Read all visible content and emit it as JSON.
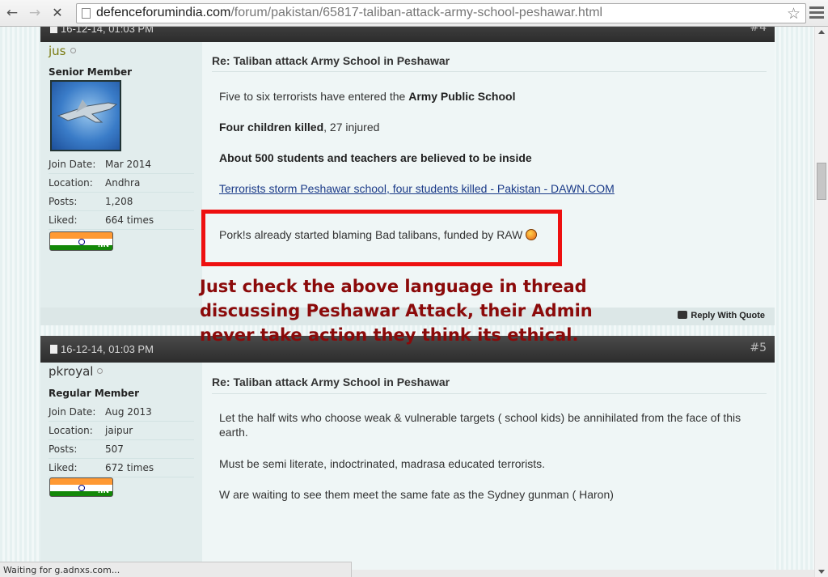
{
  "browser": {
    "url_domain": "defenceforumindia.com",
    "url_path": "/forum/pakistan/65817-taliban-attack-army-school-peshawar.html",
    "back_glyph": "←",
    "forward_glyph": "→",
    "stop_glyph": "✕",
    "star_glyph": "☆",
    "status_text": "Waiting for g.adnxs.com..."
  },
  "post1": {
    "header_date": "16-12-14, 01:03 PM",
    "post_number": "#4",
    "username": "jus",
    "user_title": "Senior Member",
    "info": [
      {
        "k": "Join Date:",
        "v": "Mar 2014"
      },
      {
        "k": "Location:",
        "v": "Andhra"
      },
      {
        "k": "Posts:",
        "v": "1,208"
      },
      {
        "k": "Liked:",
        "v": "664 times"
      }
    ],
    "flag_tld": ".IN",
    "title": "Re: Taliban attack Army School in Peshawar",
    "p1_text": "Five to six terrorists have entered the ",
    "p1_bold": "Army Public School",
    "p2_bold": "Four children killed",
    "p2_text": ", 27 injured",
    "p3_bold": "About 500 students and teachers are believed to be inside",
    "link": "Terrorists storm Peshawar school, four students killed - Pakistan - DAWN.COM",
    "quote": "Pork!s already started blaming Bad talibans, funded by RAW",
    "reply_label": "Reply With Quote"
  },
  "annotation": {
    "text": "Just check the above language in thread discussing Peshawar Attack, their Admin never take action they think its ethical.",
    "color": "#8b0a0a"
  },
  "post2": {
    "header_date": "16-12-14, 01:03 PM",
    "post_number": "#5",
    "username": "pkroyal",
    "user_title": "Regular Member",
    "info": [
      {
        "k": "Join Date:",
        "v": "Aug 2013"
      },
      {
        "k": "Location:",
        "v": "jaipur"
      },
      {
        "k": "Posts:",
        "v": "507"
      },
      {
        "k": "Liked:",
        "v": "672 times"
      }
    ],
    "flag_tld": ".IN",
    "title": "Re: Taliban attack Army School in Peshawar",
    "p1": "Let the half wits who choose weak & vulnerable targets ( school kids) be annihilated from the face of this earth.",
    "p2": "Must be semi literate, indoctrinated, madrasa educated terrorists.",
    "p3": "W are waiting to see them meet the same fate as the Sydney gunman ( Haron)"
  }
}
